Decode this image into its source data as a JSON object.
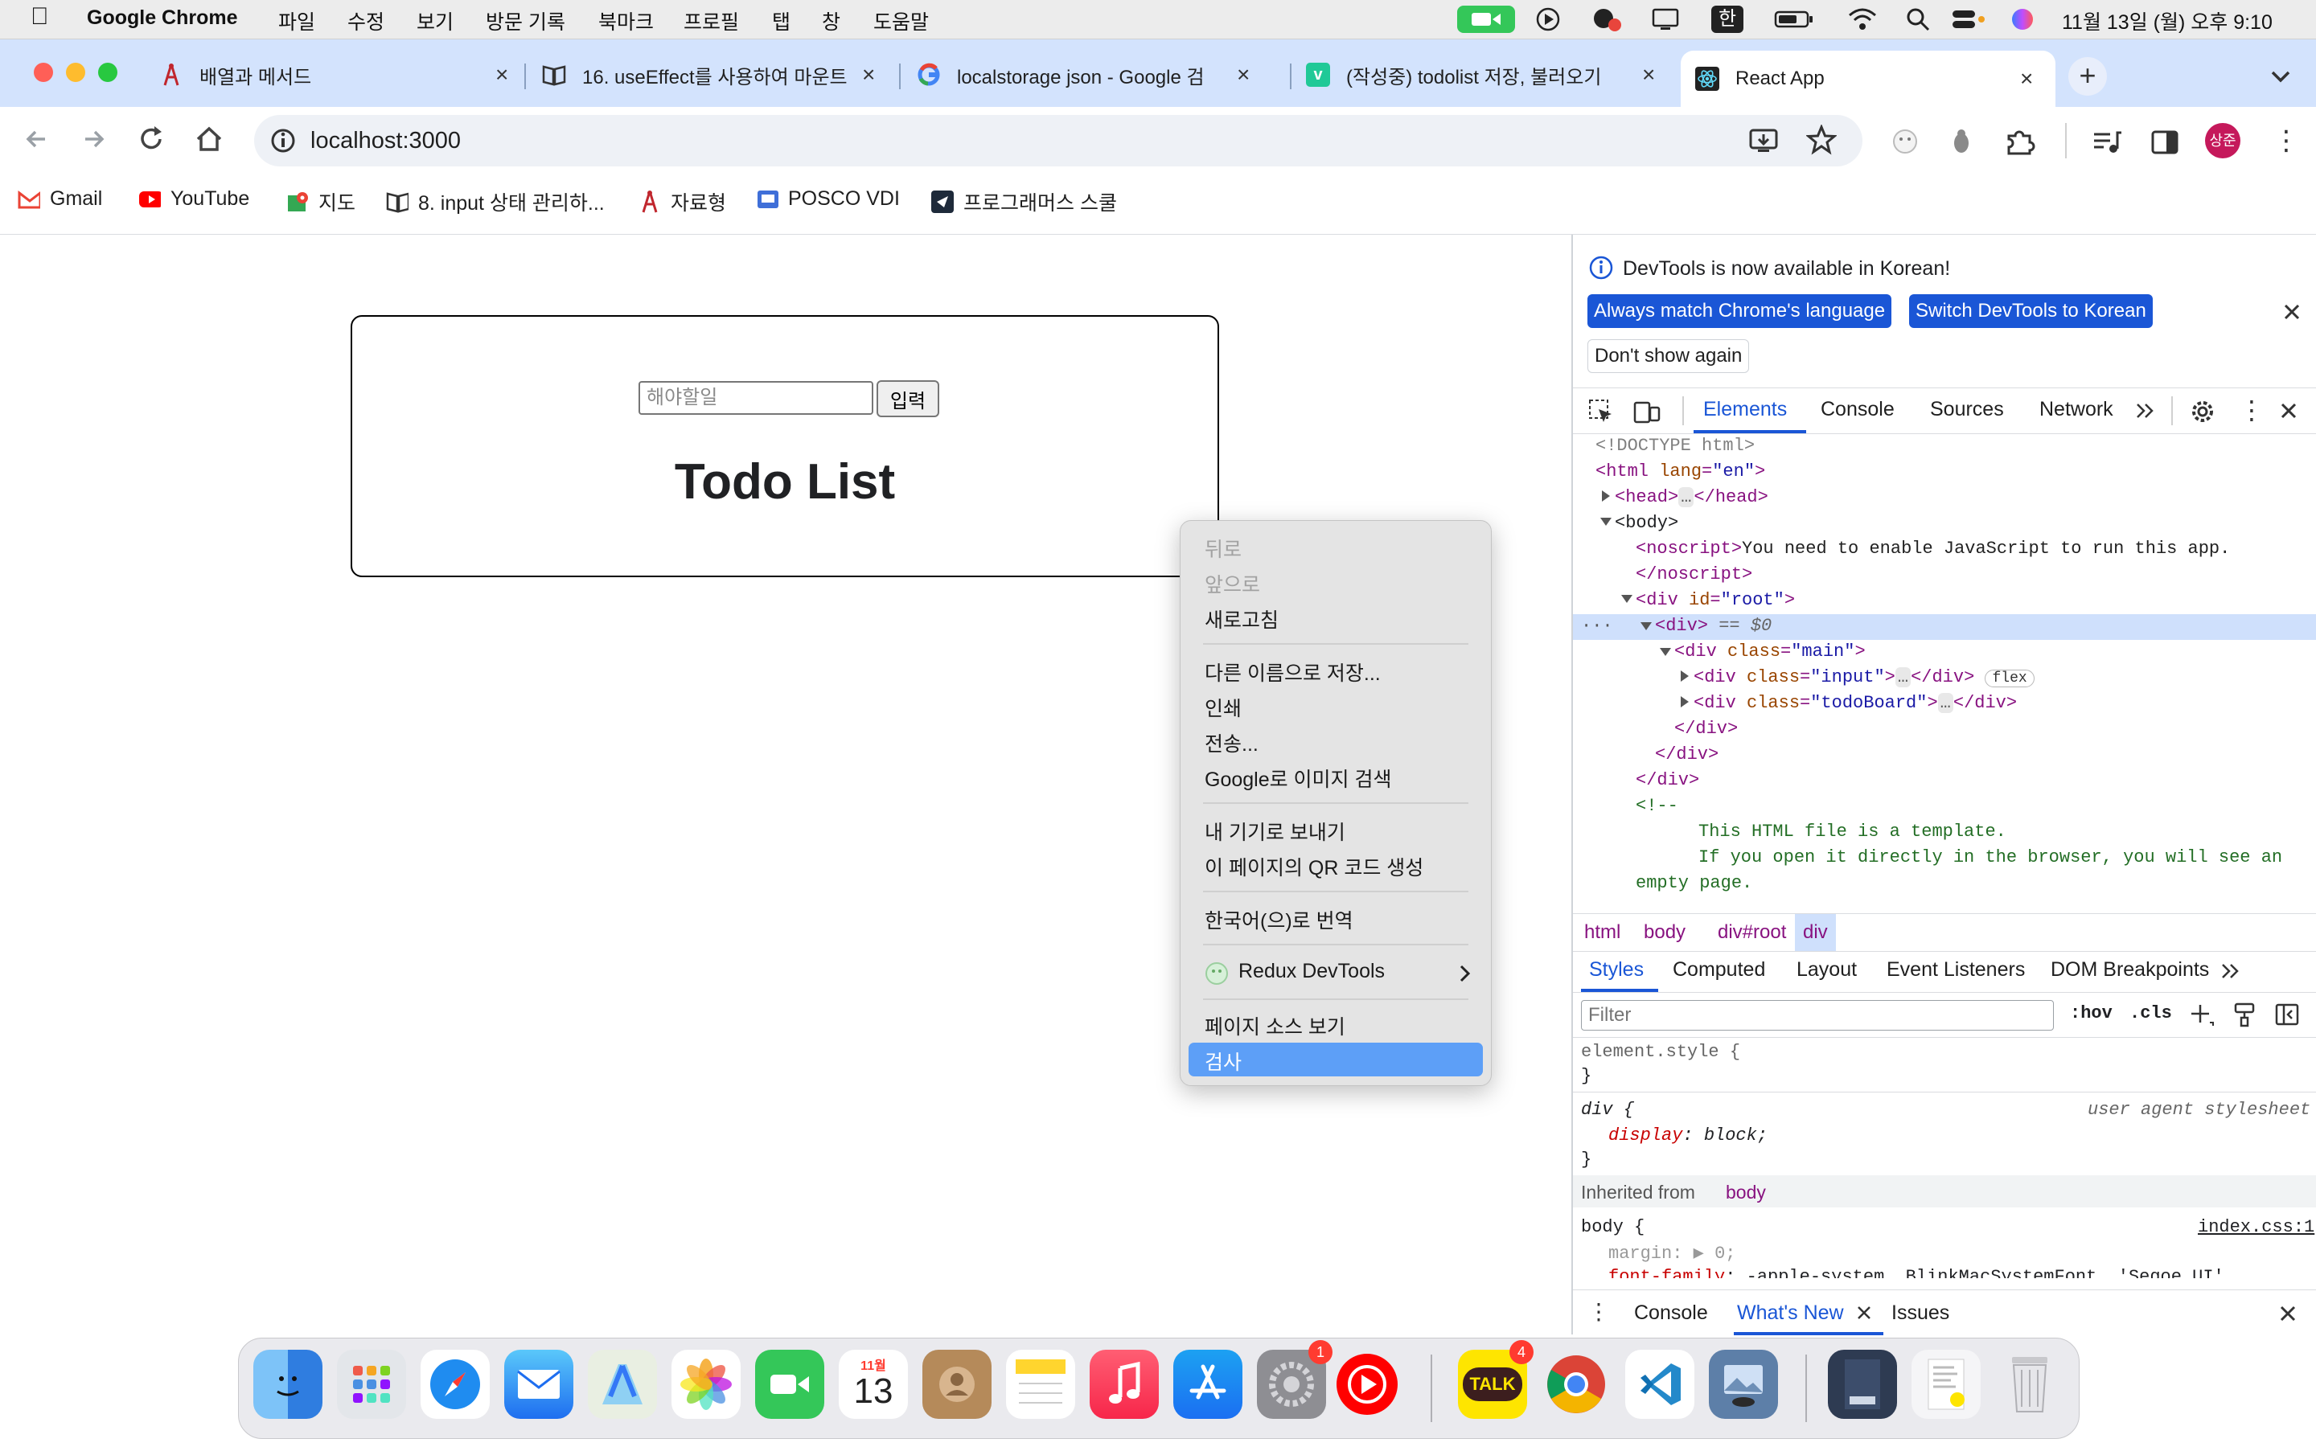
{
  "menubar": {
    "app": "Google Chrome",
    "items": [
      "파일",
      "수정",
      "보기",
      "방문 기록",
      "북마크",
      "프로필",
      "탭",
      "창",
      "도움말"
    ],
    "clock": "11월 13일 (월) 오후 9:10",
    "input_source": "한"
  },
  "tabs": [
    {
      "title": "배열과 메서드",
      "close": "×"
    },
    {
      "title": "16. useEffect를 사용하여 마운트",
      "close": "×"
    },
    {
      "title": "localstorage json - Google 검",
      "close": "×"
    },
    {
      "title": "(작성중) todolist 저장, 불러오기",
      "close": "×"
    },
    {
      "title": "React App",
      "close": "×"
    }
  ],
  "toolbar": {
    "url": "localhost:3000",
    "profile_initials": "상준"
  },
  "bookmarks": [
    "Gmail",
    "YouTube",
    "지도",
    "8. input 상태 관리하...",
    "자료형",
    "POSCO VDI",
    "프로그래머스 스쿨"
  ],
  "page": {
    "input_placeholder": "해야할일",
    "submit_label": "입력",
    "title": "Todo List"
  },
  "context_menu": {
    "items": [
      {
        "label": "뒤로",
        "disabled": true
      },
      {
        "label": "앞으로",
        "disabled": true
      },
      {
        "label": "새로고침",
        "disabled": false
      },
      {
        "label": "다른 이름으로 저장...",
        "disabled": false
      },
      {
        "label": "인쇄",
        "disabled": false
      },
      {
        "label": "전송...",
        "disabled": false
      },
      {
        "label": "Google로 이미지 검색",
        "disabled": false
      },
      {
        "label": "내 기기로 보내기",
        "disabled": false
      },
      {
        "label": "이 페이지의 QR 코드 생성",
        "disabled": false
      },
      {
        "label": "한국어(으)로 번역",
        "disabled": false
      },
      {
        "label": "Redux DevTools",
        "disabled": false
      },
      {
        "label": "페이지 소스 보기",
        "disabled": false
      },
      {
        "label": "검사",
        "disabled": false,
        "highlighted": true
      }
    ]
  },
  "devtools": {
    "banner": {
      "message": "DevTools is now available in Korean!",
      "btn_match": "Always match Chrome's language",
      "btn_switch": "Switch DevTools to Korean",
      "btn_dont_show": "Don't show again"
    },
    "tabs": [
      "Elements",
      "Console",
      "Sources",
      "Network"
    ],
    "active_tab": "Elements",
    "dom": {
      "doctype": "<!DOCTYPE html>",
      "html_open": "<html",
      "html_lang_attr": "lang",
      "html_lang_val": "\"en\"",
      "head": "<head>",
      "head_close": "</head>",
      "body": "<body>",
      "noscript_open": "<noscript>",
      "noscript_text": "You need to enable JavaScript to run this app.",
      "noscript_close": "</noscript>",
      "div_root_open": "<div",
      "id_attr": "id",
      "id_val": "\"root\"",
      "div_selected": "<div>",
      "selected_suffix": "== $0",
      "div_main_open": "<div",
      "class_attr": "class",
      "main_val": "\"main\"",
      "input_val": "\"input\"",
      "board_val": "\"todoBoard\"",
      "div_close": "</div>",
      "flex_badge": "flex",
      "ellipsis": "…",
      "comment_open": "<!--",
      "comment_l1": "This HTML file is a template.",
      "comment_l2": "If you open it directly in the browser, you will see an",
      "comment_l3": "empty page."
    },
    "breadcrumbs": [
      "html",
      "body",
      "div#root",
      "div"
    ],
    "style_tabs": [
      "Styles",
      "Computed",
      "Layout",
      "Event Listeners",
      "DOM Breakpoints"
    ],
    "filter_placeholder": "Filter",
    "hov": ":hov",
    "cls": ".cls",
    "styles": {
      "element_style": "element.style {",
      "close_brace": "}",
      "div_rule": "div {",
      "ua_label": "user agent stylesheet",
      "display_prop": "display",
      "display_val": "block;",
      "inherited_label": "Inherited from",
      "inherited_from": "body",
      "body_rule": "body {",
      "body_source": "index.css:1",
      "margin_prop": "margin",
      "margin_val": "0;",
      "font_prop": "font-family",
      "font_val": "-apple-system, BlinkMacSystemFont, 'Segoe UI',"
    },
    "drawer_tabs": [
      "Console",
      "What's New",
      "Issues"
    ],
    "drawer_active": "What's New"
  },
  "dock": {
    "calendar_month": "11월",
    "calendar_day": "13",
    "settings_badge": "1",
    "kakao_badge": "4",
    "kakao_label": "TALK"
  }
}
